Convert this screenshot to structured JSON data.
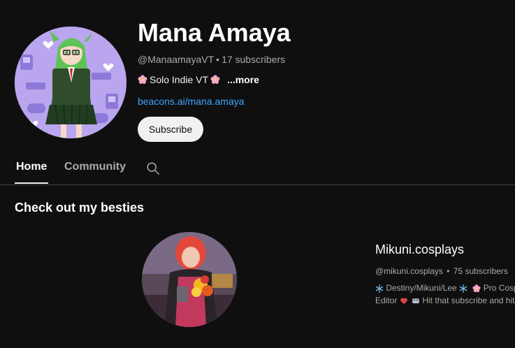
{
  "channel": {
    "name": "Mana Amaya",
    "handle": "@ManaamayaVT",
    "meta_separator": "•",
    "subscribers": "17 subscribers",
    "description": "Solo Indie VT",
    "more_label": "...more",
    "link": "beacons.ai/mana.amaya",
    "subscribe_label": "Subscribe"
  },
  "tabs": [
    {
      "label": "Home",
      "active": true
    },
    {
      "label": "Community",
      "active": false
    }
  ],
  "section": {
    "title": "Check out my besties"
  },
  "featured_channel": {
    "name": "Mikuni.cosplays",
    "handle": "@mikuni.cosplays",
    "separator": "•",
    "subscribers": "75 subscribers",
    "desc_line1_a": "Destiny/Mikuni/Lee",
    "desc_line1_b": "Pro Cosp",
    "desc_line2_a": "Editor",
    "desc_line2_b": "Hit that subscribe and hit t"
  },
  "icons": {
    "flower": "cherry-blossom-icon",
    "snowflake": "snowflake-icon",
    "search": "search-icon"
  },
  "colors": {
    "background": "#0f0f0f",
    "link": "#3ea6ff",
    "secondary_text": "#aaaaaa",
    "button_bg": "#f1f1f1"
  }
}
